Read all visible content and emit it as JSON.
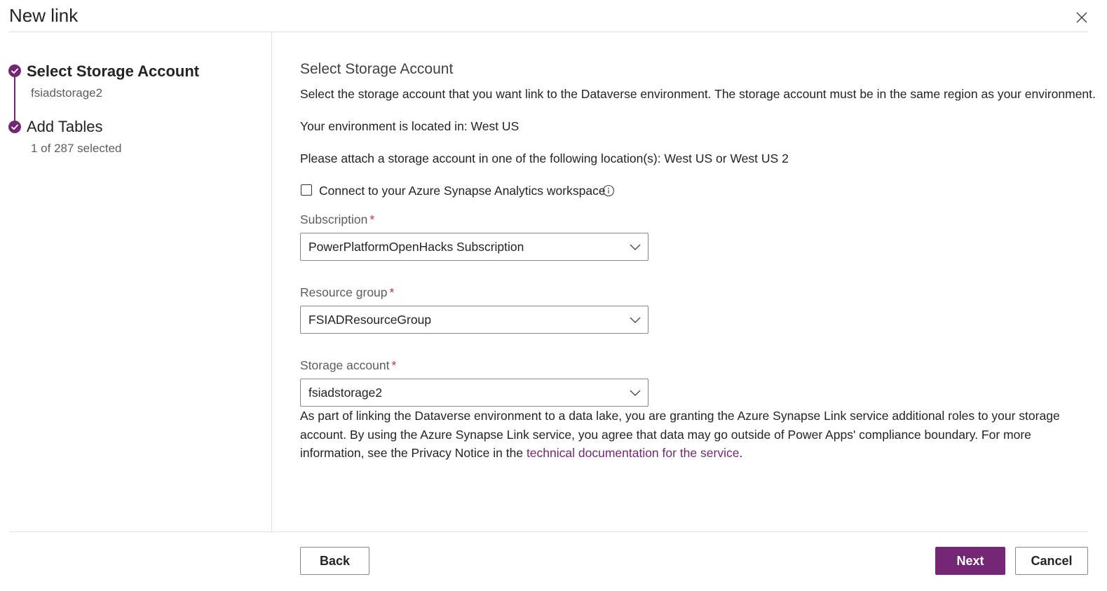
{
  "header": {
    "title": "New link"
  },
  "steps": [
    {
      "title": "Select Storage Account",
      "subtitle": "fsiadstorage2",
      "active": true
    },
    {
      "title": "Add Tables",
      "subtitle": "1 of 287 selected",
      "active": false
    }
  ],
  "main": {
    "heading": "Select Storage Account",
    "description": "Select the storage account that you want link to the Dataverse environment. The storage account must be in the same region as your environment.",
    "environment_location": "Your environment is located in: West US",
    "attach_instruction": "Please attach a storage account in one of the following location(s): West US or West US 2",
    "synapse_checkbox": {
      "label": "Connect to your Azure Synapse Analytics workspace",
      "checked": false
    },
    "subscription": {
      "label": "Subscription",
      "required_marker": "*",
      "value": "PowerPlatformOpenHacks Subscription"
    },
    "resource_group": {
      "label": "Resource group",
      "required_marker": "*",
      "value": "FSIADResourceGroup"
    },
    "storage_account": {
      "label": "Storage account",
      "required_marker": "*",
      "value": "fsiadstorage2"
    },
    "notice": {
      "text_before_link": "As part of linking the Dataverse environment to a data lake, you are granting the Azure Synapse Link service additional roles to your storage account. By using the Azure Synapse Link service, you agree that data may go outside of Power Apps' compliance boundary. For more information, see the Privacy Notice in the ",
      "link_text": "technical documentation for the service",
      "text_after_link": "."
    }
  },
  "footer": {
    "back_label": "Back",
    "next_label": "Next",
    "cancel_label": "Cancel"
  },
  "colors": {
    "accent": "#742774",
    "required": "#c4314b",
    "divider": "#e1e1e1"
  }
}
